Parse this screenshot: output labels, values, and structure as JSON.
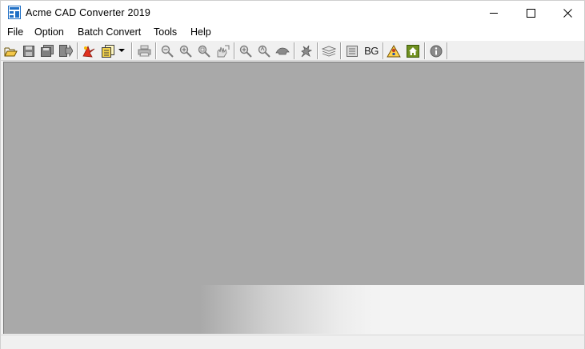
{
  "window": {
    "title": "Acme CAD Converter 2019",
    "minimize_icon": "minimize-icon",
    "maximize_icon": "maximize-icon",
    "close_icon": "close-icon"
  },
  "menu": {
    "items": [
      {
        "label": "File"
      },
      {
        "label": "Option"
      },
      {
        "label": "Batch Convert"
      },
      {
        "label": "Tools"
      },
      {
        "label": "Help"
      }
    ]
  },
  "toolbar": {
    "buttons": [
      {
        "icon": "open-folder-icon"
      },
      {
        "icon": "save-icon"
      },
      {
        "icon": "save-all-icon"
      },
      {
        "icon": "export-icon"
      },
      {
        "icon": "convert-icon"
      },
      {
        "icon": "batch-convert-icon"
      },
      {
        "icon": "dropdown-arrow-icon"
      },
      {
        "icon": "print-icon"
      },
      {
        "icon": "zoom-out-icon"
      },
      {
        "icon": "zoom-in-icon"
      },
      {
        "icon": "zoom-window-icon"
      },
      {
        "icon": "pan-icon"
      },
      {
        "icon": "zoom-extents-icon"
      },
      {
        "icon": "zoom-realtime-icon"
      },
      {
        "icon": "view-icon"
      },
      {
        "icon": "redraw-icon"
      },
      {
        "icon": "layers-icon"
      },
      {
        "icon": "properties-icon"
      },
      {
        "icon": "background-color-icon",
        "label": "BG"
      },
      {
        "icon": "warning-icon"
      },
      {
        "icon": "home-icon"
      },
      {
        "icon": "info-icon"
      }
    ]
  },
  "colors": {
    "canvas_background": "#a9a9a9",
    "toolbar_background": "#f0f0f0",
    "workspace_background": "#f2f2f2",
    "app_icon_blue": "#1f6fc5"
  }
}
